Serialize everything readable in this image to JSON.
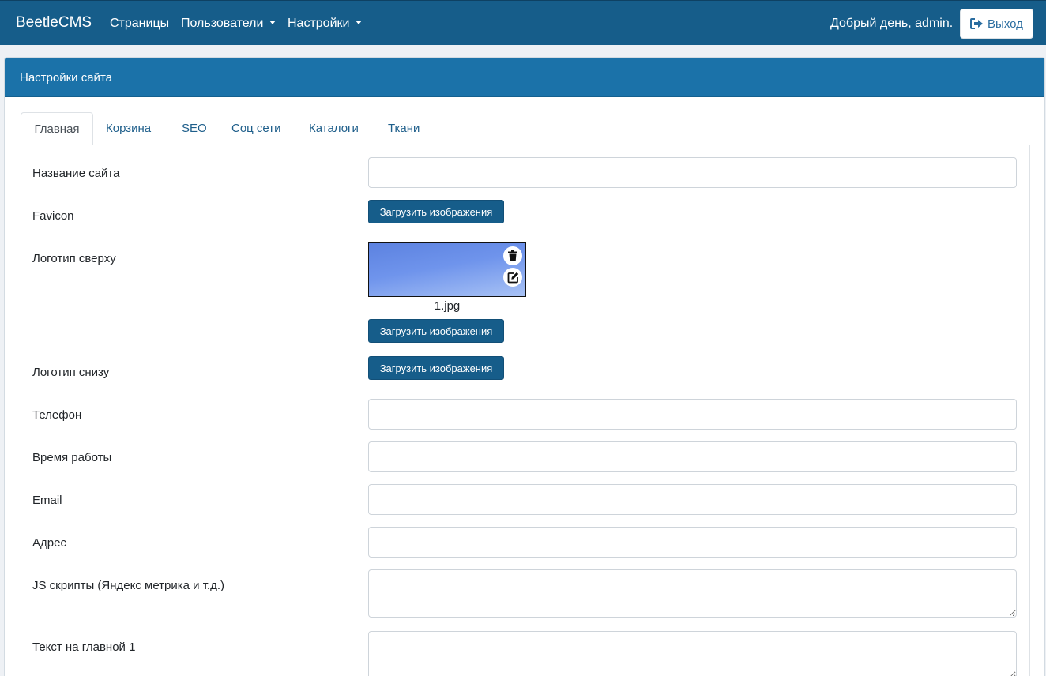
{
  "navbar": {
    "brand": "BeetleCMS",
    "items": [
      {
        "label": "Страницы"
      },
      {
        "label": "Пользователи"
      },
      {
        "label": "Настройки"
      }
    ],
    "greeting": "Добрый день, admin.",
    "logout_label": "Выход"
  },
  "card": {
    "title": "Настройки сайта",
    "tabs": [
      {
        "label": "Главная",
        "active": true
      },
      {
        "label": "Корзина"
      },
      {
        "label": "SEO"
      },
      {
        "label": "Соц сети"
      },
      {
        "label": "Каталоги"
      },
      {
        "label": "Ткани"
      }
    ]
  },
  "form": {
    "site_name": {
      "label": "Название сайта",
      "value": ""
    },
    "favicon": {
      "label": "Favicon",
      "button": "Загрузить изображения"
    },
    "logo_top": {
      "label": "Логотип сверху",
      "filename": "1.jpg",
      "button": "Загрузить изображения"
    },
    "logo_bottom": {
      "label": "Логотип снизу",
      "button": "Загрузить изображения"
    },
    "phone": {
      "label": "Телефон",
      "value": ""
    },
    "work_time": {
      "label": "Время работы",
      "value": ""
    },
    "email": {
      "label": "Email",
      "value": ""
    },
    "address": {
      "label": "Адрес",
      "value": ""
    },
    "js_scripts": {
      "label": "JS скрипты (Яндекс метрика и т.д.)",
      "value": ""
    },
    "main_text_1": {
      "label": "Текст на главной 1",
      "value": ""
    }
  },
  "icons": {
    "logout": "sign-out-icon",
    "delete": "trash-icon",
    "edit": "edit-icon"
  },
  "colors": {
    "navbar": "#165d8a",
    "card_header": "#1b72a9",
    "button": "#165d8a",
    "tab_link": "#1f5f8b"
  }
}
